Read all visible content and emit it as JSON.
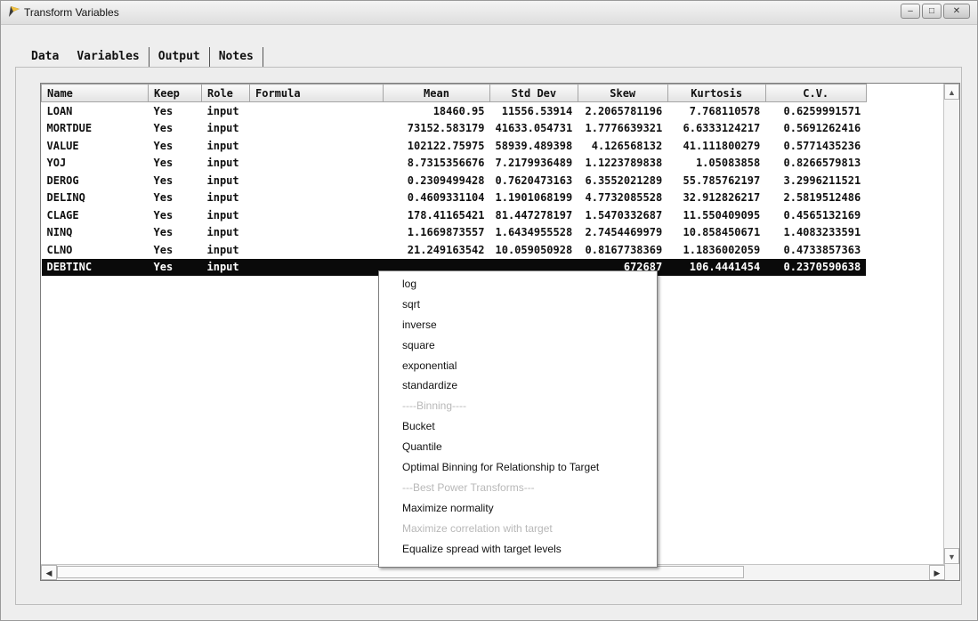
{
  "window": {
    "title": "Transform Variables",
    "controls": [
      "–",
      "□",
      "✕"
    ]
  },
  "tabs": [
    "Data",
    "Variables",
    "Output",
    "Notes"
  ],
  "table": {
    "columns": [
      "Name",
      "Keep",
      "Role",
      "Formula",
      "Mean",
      "Std Dev",
      "Skew",
      "Kurtosis",
      "C.V."
    ],
    "rows": [
      [
        "LOAN",
        "Yes",
        "input",
        "",
        "18460.95",
        "11556.53914",
        "2.2065781196",
        "7.768110578",
        "0.6259991571"
      ],
      [
        "MORTDUE",
        "Yes",
        "input",
        "",
        "73152.583179",
        "41633.054731",
        "1.7776639321",
        "6.6333124217",
        "0.5691262416"
      ],
      [
        "VALUE",
        "Yes",
        "input",
        "",
        "102122.75975",
        "58939.489398",
        "4.126568132",
        "41.111800279",
        "0.5771435236"
      ],
      [
        "YOJ",
        "Yes",
        "input",
        "",
        "8.7315356676",
        "7.2179936489",
        "1.1223789838",
        "1.05083858",
        "0.8266579813"
      ],
      [
        "DEROG",
        "Yes",
        "input",
        "",
        "0.2309499428",
        "0.7620473163",
        "6.3552021289",
        "55.785762197",
        "3.2996211521"
      ],
      [
        "DELINQ",
        "Yes",
        "input",
        "",
        "0.4609331104",
        "1.1901068199",
        "4.7732085528",
        "32.912826217",
        "2.5819512486"
      ],
      [
        "CLAGE",
        "Yes",
        "input",
        "",
        "178.41165421",
        "81.447278197",
        "1.5470332687",
        "11.550409095",
        "0.4565132169"
      ],
      [
        "NINQ",
        "Yes",
        "input",
        "",
        "1.1669873557",
        "1.6434955528",
        "2.7454469979",
        "10.858450671",
        "1.4083233591"
      ],
      [
        "CLNO",
        "Yes",
        "input",
        "",
        "21.249163542",
        "10.059050928",
        "0.8167738369",
        "1.1836002059",
        "0.4733857363"
      ],
      [
        "DEBTINC",
        "Yes",
        "input",
        "",
        "",
        "",
        "672687",
        "106.4441454",
        "0.2370590638"
      ]
    ],
    "selected_row": 9
  },
  "context_menu": {
    "items": [
      {
        "label": "log",
        "enabled": true
      },
      {
        "label": "sqrt",
        "enabled": true
      },
      {
        "label": "inverse",
        "enabled": true
      },
      {
        "label": "square",
        "enabled": true
      },
      {
        "label": "exponential",
        "enabled": true
      },
      {
        "label": "standardize",
        "enabled": true
      },
      {
        "label": "----Binning----",
        "enabled": false,
        "separator": true
      },
      {
        "label": "Bucket",
        "enabled": true
      },
      {
        "label": "Quantile",
        "enabled": true
      },
      {
        "label": "Optimal Binning for Relationship to Target",
        "enabled": true
      },
      {
        "label": "---Best Power Transforms---",
        "enabled": false,
        "separator": true
      },
      {
        "label": "Maximize normality",
        "enabled": true
      },
      {
        "label": "Maximize correlation with target",
        "enabled": false
      },
      {
        "label": "Equalize spread with target levels",
        "enabled": true
      }
    ]
  }
}
